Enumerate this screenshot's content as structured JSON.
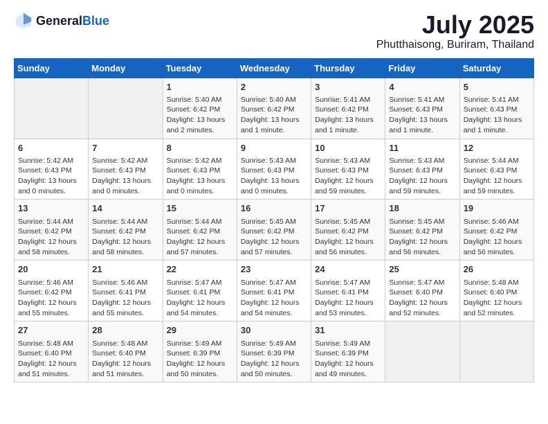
{
  "header": {
    "logo_general": "General",
    "logo_blue": "Blue",
    "title": "July 2025",
    "subtitle": "Phutthaisong, Buriram, Thailand"
  },
  "weekdays": [
    "Sunday",
    "Monday",
    "Tuesday",
    "Wednesday",
    "Thursday",
    "Friday",
    "Saturday"
  ],
  "weeks": [
    [
      {
        "day": "",
        "info": ""
      },
      {
        "day": "",
        "info": ""
      },
      {
        "day": "1",
        "info": "Sunrise: 5:40 AM\nSunset: 6:42 PM\nDaylight: 13 hours and 2 minutes."
      },
      {
        "day": "2",
        "info": "Sunrise: 5:40 AM\nSunset: 6:42 PM\nDaylight: 13 hours and 1 minute."
      },
      {
        "day": "3",
        "info": "Sunrise: 5:41 AM\nSunset: 6:42 PM\nDaylight: 13 hours and 1 minute."
      },
      {
        "day": "4",
        "info": "Sunrise: 5:41 AM\nSunset: 6:43 PM\nDaylight: 13 hours and 1 minute."
      },
      {
        "day": "5",
        "info": "Sunrise: 5:41 AM\nSunset: 6:43 PM\nDaylight: 13 hours and 1 minute."
      }
    ],
    [
      {
        "day": "6",
        "info": "Sunrise: 5:42 AM\nSunset: 6:43 PM\nDaylight: 13 hours and 0 minutes."
      },
      {
        "day": "7",
        "info": "Sunrise: 5:42 AM\nSunset: 6:43 PM\nDaylight: 13 hours and 0 minutes."
      },
      {
        "day": "8",
        "info": "Sunrise: 5:42 AM\nSunset: 6:43 PM\nDaylight: 13 hours and 0 minutes."
      },
      {
        "day": "9",
        "info": "Sunrise: 5:43 AM\nSunset: 6:43 PM\nDaylight: 13 hours and 0 minutes."
      },
      {
        "day": "10",
        "info": "Sunrise: 5:43 AM\nSunset: 6:43 PM\nDaylight: 12 hours and 59 minutes."
      },
      {
        "day": "11",
        "info": "Sunrise: 5:43 AM\nSunset: 6:43 PM\nDaylight: 12 hours and 59 minutes."
      },
      {
        "day": "12",
        "info": "Sunrise: 5:44 AM\nSunset: 6:43 PM\nDaylight: 12 hours and 59 minutes."
      }
    ],
    [
      {
        "day": "13",
        "info": "Sunrise: 5:44 AM\nSunset: 6:42 PM\nDaylight: 12 hours and 58 minutes."
      },
      {
        "day": "14",
        "info": "Sunrise: 5:44 AM\nSunset: 6:42 PM\nDaylight: 12 hours and 58 minutes."
      },
      {
        "day": "15",
        "info": "Sunrise: 5:44 AM\nSunset: 6:42 PM\nDaylight: 12 hours and 57 minutes."
      },
      {
        "day": "16",
        "info": "Sunrise: 5:45 AM\nSunset: 6:42 PM\nDaylight: 12 hours and 57 minutes."
      },
      {
        "day": "17",
        "info": "Sunrise: 5:45 AM\nSunset: 6:42 PM\nDaylight: 12 hours and 56 minutes."
      },
      {
        "day": "18",
        "info": "Sunrise: 5:45 AM\nSunset: 6:42 PM\nDaylight: 12 hours and 56 minutes."
      },
      {
        "day": "19",
        "info": "Sunrise: 5:46 AM\nSunset: 6:42 PM\nDaylight: 12 hours and 56 minutes."
      }
    ],
    [
      {
        "day": "20",
        "info": "Sunrise: 5:46 AM\nSunset: 6:42 PM\nDaylight: 12 hours and 55 minutes."
      },
      {
        "day": "21",
        "info": "Sunrise: 5:46 AM\nSunset: 6:41 PM\nDaylight: 12 hours and 55 minutes."
      },
      {
        "day": "22",
        "info": "Sunrise: 5:47 AM\nSunset: 6:41 PM\nDaylight: 12 hours and 54 minutes."
      },
      {
        "day": "23",
        "info": "Sunrise: 5:47 AM\nSunset: 6:41 PM\nDaylight: 12 hours and 54 minutes."
      },
      {
        "day": "24",
        "info": "Sunrise: 5:47 AM\nSunset: 6:41 PM\nDaylight: 12 hours and 53 minutes."
      },
      {
        "day": "25",
        "info": "Sunrise: 5:47 AM\nSunset: 6:40 PM\nDaylight: 12 hours and 52 minutes."
      },
      {
        "day": "26",
        "info": "Sunrise: 5:48 AM\nSunset: 6:40 PM\nDaylight: 12 hours and 52 minutes."
      }
    ],
    [
      {
        "day": "27",
        "info": "Sunrise: 5:48 AM\nSunset: 6:40 PM\nDaylight: 12 hours and 51 minutes."
      },
      {
        "day": "28",
        "info": "Sunrise: 5:48 AM\nSunset: 6:40 PM\nDaylight: 12 hours and 51 minutes."
      },
      {
        "day": "29",
        "info": "Sunrise: 5:49 AM\nSunset: 6:39 PM\nDaylight: 12 hours and 50 minutes."
      },
      {
        "day": "30",
        "info": "Sunrise: 5:49 AM\nSunset: 6:39 PM\nDaylight: 12 hours and 50 minutes."
      },
      {
        "day": "31",
        "info": "Sunrise: 5:49 AM\nSunset: 6:39 PM\nDaylight: 12 hours and 49 minutes."
      },
      {
        "day": "",
        "info": ""
      },
      {
        "day": "",
        "info": ""
      }
    ]
  ]
}
